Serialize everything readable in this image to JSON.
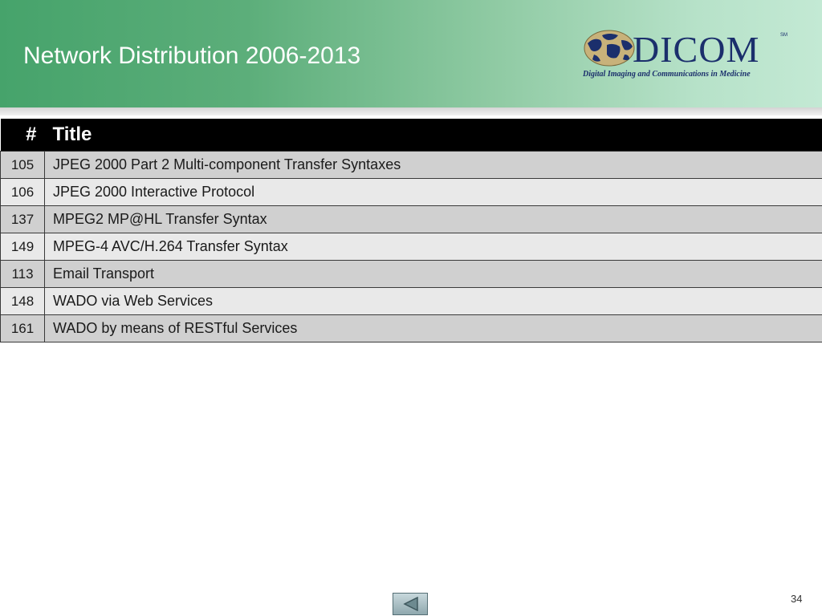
{
  "slide": {
    "title": "Network Distribution 2006-2013",
    "page_number": "34"
  },
  "logo": {
    "word": "DICOM",
    "sm": "SM",
    "tagline": "Digital Imaging and Communications in Medicine"
  },
  "table": {
    "headers": {
      "num": "#",
      "title": "Title"
    },
    "rows": [
      {
        "num": "105",
        "title": "JPEG 2000 Part 2 Multi-component Transfer Syntaxes"
      },
      {
        "num": "106",
        "title": "JPEG 2000 Interactive Protocol"
      },
      {
        "num": "137",
        "title": "MPEG2 MP@HL Transfer Syntax"
      },
      {
        "num": "149",
        "title": "MPEG-4 AVC/H.264 Transfer Syntax"
      },
      {
        "num": "113",
        "title": "Email Transport"
      },
      {
        "num": "148",
        "title": "WADO via Web Services"
      },
      {
        "num": "161",
        "title": "WADO by means of RESTful Services"
      }
    ]
  },
  "navigation": {
    "back_icon": "triangle-left-icon"
  },
  "colors": {
    "header_green": "#46a36b",
    "logo_navy": "#1b2f6c",
    "table_header": "#000000",
    "row_dark": "#d0d0d0",
    "row_light": "#e9e9e9"
  }
}
